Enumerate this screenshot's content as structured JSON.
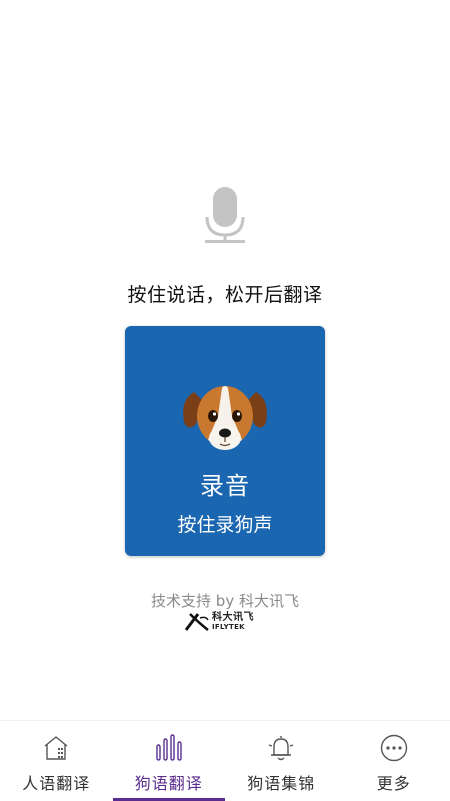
{
  "main": {
    "mic_icon": "microphone-icon",
    "instruction": "按住说话，松开后翻译",
    "record_button": {
      "title": "录音",
      "subtitle": "按住录狗声",
      "icon": "dog-face-icon",
      "color": "#1b66b1"
    },
    "support_text": "技术支持 by 科大讯飞",
    "logo": {
      "cn": "科大讯飞",
      "en": "IFLYTEK"
    }
  },
  "tabbar": {
    "active_color": "#5b2d8e",
    "tabs": [
      {
        "label": "人语翻译",
        "icon": "house-icon",
        "active": false
      },
      {
        "label": "狗语翻译",
        "icon": "sound-bars-icon",
        "active": true
      },
      {
        "label": "狗语集锦",
        "icon": "bell-icon",
        "active": false
      },
      {
        "label": "更多",
        "icon": "more-dots-icon",
        "active": false
      }
    ]
  }
}
